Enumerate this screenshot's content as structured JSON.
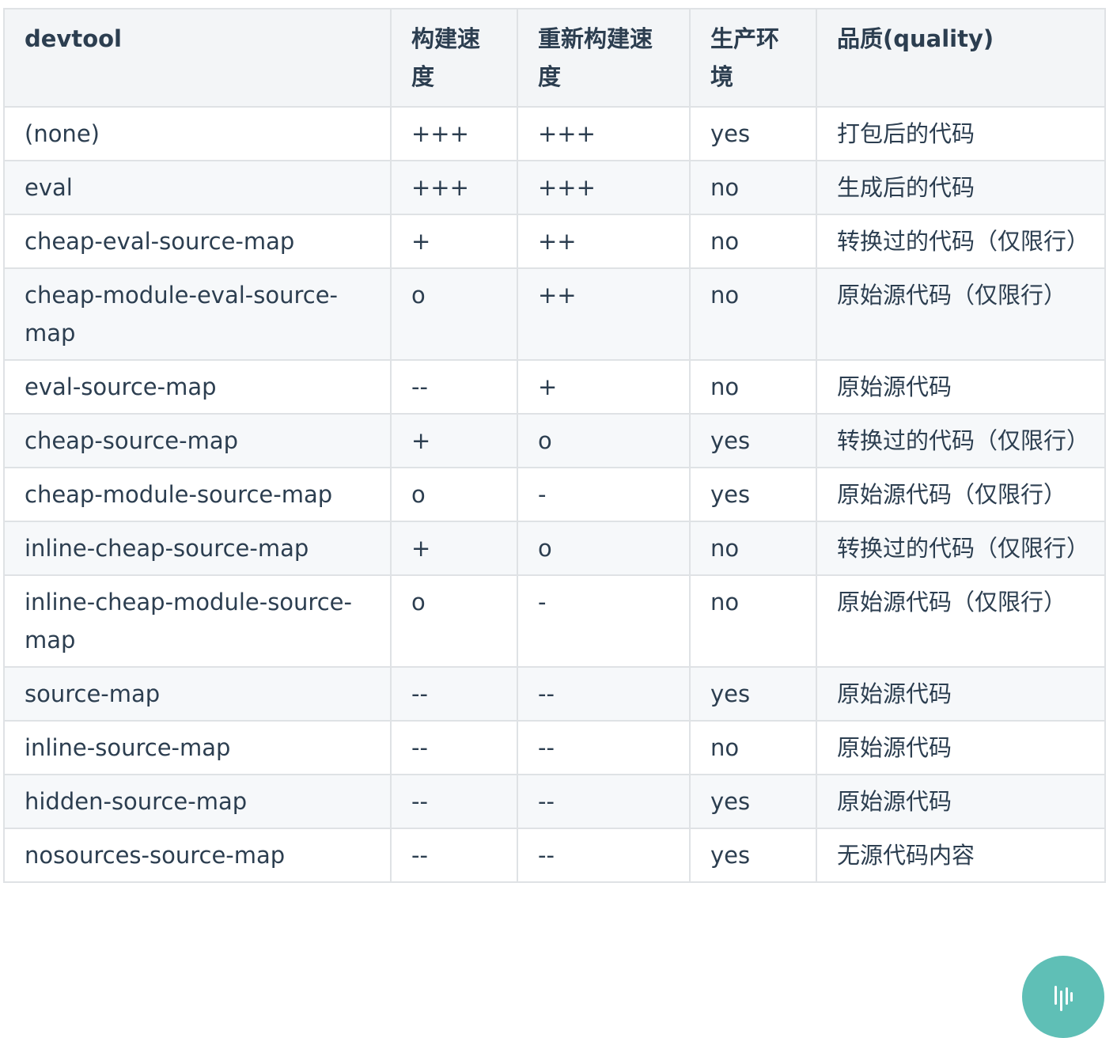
{
  "table": {
    "headers": [
      "devtool",
      "构建速度",
      "重新构建速度",
      "生产环境",
      "品质(quality)"
    ],
    "rows": [
      [
        "(none)",
        "+++",
        "+++",
        "yes",
        "打包后的代码"
      ],
      [
        "eval",
        "+++",
        "+++",
        "no",
        "生成后的代码"
      ],
      [
        "cheap-eval-source-map",
        "+",
        "++",
        "no",
        "转换过的代码（仅限行）"
      ],
      [
        "cheap-module-eval-source-map",
        "o",
        "++",
        "no",
        "原始源代码（仅限行）"
      ],
      [
        "eval-source-map",
        "--",
        "+",
        "no",
        "原始源代码"
      ],
      [
        "cheap-source-map",
        "+",
        "o",
        "yes",
        "转换过的代码（仅限行）"
      ],
      [
        "cheap-module-source-map",
        "o",
        "-",
        "yes",
        "原始源代码（仅限行）"
      ],
      [
        "inline-cheap-source-map",
        "+",
        "o",
        "no",
        "转换过的代码（仅限行）"
      ],
      [
        "inline-cheap-module-source-map",
        "o",
        "-",
        "no",
        "原始源代码（仅限行）"
      ],
      [
        "source-map",
        "--",
        "--",
        "yes",
        "原始源代码"
      ],
      [
        "inline-source-map",
        "--",
        "--",
        "no",
        "原始源代码"
      ],
      [
        "hidden-source-map",
        "--",
        "--",
        "yes",
        "原始源代码"
      ],
      [
        "nosources-source-map",
        "--",
        "--",
        "yes",
        "无源代码内容"
      ]
    ]
  },
  "fab": {
    "icon": "sound-wave-icon",
    "color": "#5fbfb6"
  }
}
